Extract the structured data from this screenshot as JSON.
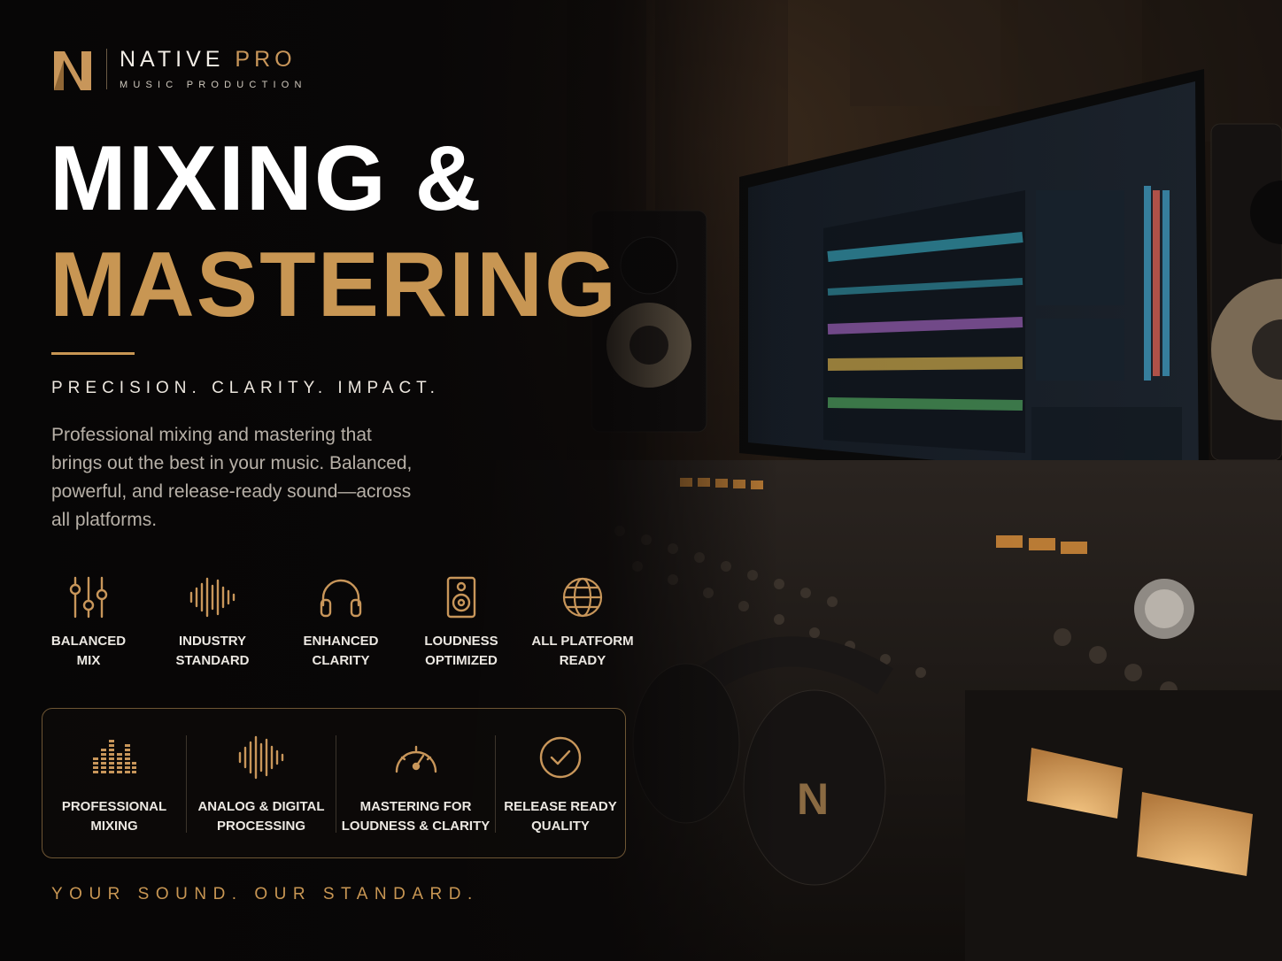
{
  "brand": {
    "name_primary": "NATIVE",
    "name_accent": "PRO",
    "subtitle": "MUSIC PRODUCTION"
  },
  "hero": {
    "title_line1": "MIXING &",
    "title_line2": "MASTERING",
    "tagline": "PRECISION. CLARITY. IMPACT.",
    "description": "Professional mixing and mastering that brings out the best in your music. Balanced, powerful, and release-ready sound—across all platforms."
  },
  "features": [
    {
      "icon": "sliders-icon",
      "line1": "BALANCED",
      "line2": "MIX"
    },
    {
      "icon": "waveform-icon",
      "line1": "INDUSTRY",
      "line2": "STANDARD"
    },
    {
      "icon": "headphones-icon",
      "line1": "ENHANCED",
      "line2": "CLARITY"
    },
    {
      "icon": "speaker-icon",
      "line1": "LOUDNESS",
      "line2": "OPTIMIZED"
    },
    {
      "icon": "globe-icon",
      "line1": "ALL PLATFORM",
      "line2": "READY"
    }
  ],
  "services": [
    {
      "icon": "level-meter-icon",
      "line1": "PROFESSIONAL",
      "line2": "MIXING"
    },
    {
      "icon": "waveform-icon",
      "line1": "ANALOG & DIGITAL",
      "line2": "PROCESSING"
    },
    {
      "icon": "gauge-icon",
      "line1": "MASTERING FOR",
      "line2": "LOUDNESS & CLARITY"
    },
    {
      "icon": "check-circle-icon",
      "line1": "RELEASE READY",
      "line2": "QUALITY"
    }
  ],
  "footer": {
    "slogan": "YOUR SOUND. OUR STANDARD."
  },
  "colors": {
    "accent": "#c89653",
    "background": "#0b0908",
    "text": "#ffffff",
    "muted_text": "#b7b0a7"
  }
}
